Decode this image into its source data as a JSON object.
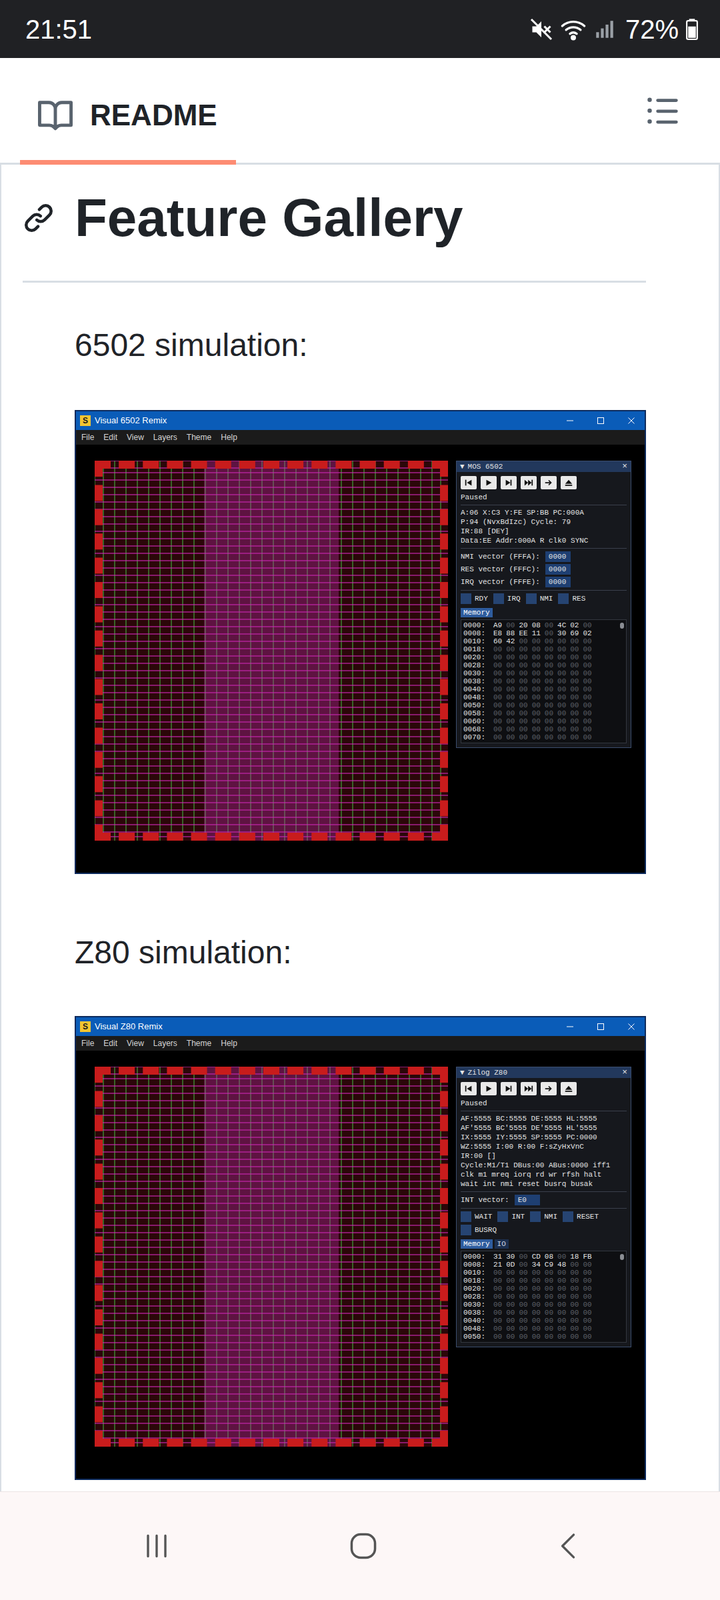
{
  "status_bar": {
    "time": "21:51",
    "battery": "72%"
  },
  "header": {
    "tabs": [
      {
        "label": "README",
        "selected": true
      }
    ]
  },
  "article": {
    "title": "Feature Gallery",
    "sections": [
      {
        "caption": "6502 simulation:",
        "window": {
          "logo": "S",
          "title": "Visual 6502 Remix",
          "menu": [
            "File",
            "Edit",
            "View",
            "Layers",
            "Theme",
            "Help"
          ],
          "panel": {
            "collapse": "▼",
            "title": "MOS 6502",
            "close": "×",
            "status": "Paused",
            "registers": [
              "A:06 X:C3 Y:FE SP:BB PC:000A",
              "P:94 (NvxBdIzc) Cycle: 79",
              "IR:88 [DEY]",
              "Data:EE Addr:000A R clk0 SYNC"
            ],
            "vectors": [
              {
                "label": "NMI vector (FFFA):",
                "value": "0000"
              },
              {
                "label": "RES vector (FFFC):",
                "value": "0000"
              },
              {
                "label": "IRQ vector (FFFE):",
                "value": "0000"
              }
            ],
            "pins": [
              {
                "label": "RDY",
                "checked": false
              },
              {
                "label": "IRQ",
                "checked": false
              },
              {
                "label": "NMI",
                "checked": false
              },
              {
                "label": "RES",
                "checked": false
              }
            ],
            "tabs": [
              {
                "label": "Memory",
                "selected": true
              }
            ],
            "memory": [
              {
                "address": "0000:",
                "bytes": [
                  "A9",
                  "00",
                  "20",
                  "08",
                  "00",
                  "4C",
                  "02",
                  "00"
                ]
              },
              {
                "address": "0008:",
                "bytes": [
                  "E8",
                  "88",
                  "EE",
                  "11",
                  "00",
                  "30",
                  "69",
                  "02"
                ]
              },
              {
                "address": "0010:",
                "bytes": [
                  "60",
                  "42",
                  "00",
                  "00",
                  "00",
                  "00",
                  "00",
                  "00"
                ]
              },
              {
                "address": "0018:",
                "bytes": [
                  "00",
                  "00",
                  "00",
                  "00",
                  "00",
                  "00",
                  "00",
                  "00"
                ]
              },
              {
                "address": "0020:",
                "bytes": [
                  "00",
                  "00",
                  "00",
                  "00",
                  "00",
                  "00",
                  "00",
                  "00"
                ]
              },
              {
                "address": "0028:",
                "bytes": [
                  "00",
                  "00",
                  "00",
                  "00",
                  "00",
                  "00",
                  "00",
                  "00"
                ]
              },
              {
                "address": "0030:",
                "bytes": [
                  "00",
                  "00",
                  "00",
                  "00",
                  "00",
                  "00",
                  "00",
                  "00"
                ]
              },
              {
                "address": "0038:",
                "bytes": [
                  "00",
                  "00",
                  "00",
                  "00",
                  "00",
                  "00",
                  "00",
                  "00"
                ]
              },
              {
                "address": "0040:",
                "bytes": [
                  "00",
                  "00",
                  "00",
                  "00",
                  "00",
                  "00",
                  "00",
                  "00"
                ]
              },
              {
                "address": "0048:",
                "bytes": [
                  "00",
                  "00",
                  "00",
                  "00",
                  "00",
                  "00",
                  "00",
                  "00"
                ]
              },
              {
                "address": "0050:",
                "bytes": [
                  "00",
                  "00",
                  "00",
                  "00",
                  "00",
                  "00",
                  "00",
                  "00"
                ]
              },
              {
                "address": "0058:",
                "bytes": [
                  "00",
                  "00",
                  "00",
                  "00",
                  "00",
                  "00",
                  "00",
                  "00"
                ]
              },
              {
                "address": "0060:",
                "bytes": [
                  "00",
                  "00",
                  "00",
                  "00",
                  "00",
                  "00",
                  "00",
                  "00"
                ]
              },
              {
                "address": "0068:",
                "bytes": [
                  "00",
                  "00",
                  "00",
                  "00",
                  "00",
                  "00",
                  "00",
                  "00"
                ]
              },
              {
                "address": "0070:",
                "bytes": [
                  "00",
                  "00",
                  "00",
                  "00",
                  "00",
                  "00",
                  "00",
                  "00"
                ]
              }
            ]
          }
        }
      },
      {
        "caption": "Z80 simulation:",
        "window": {
          "logo": "S",
          "title": "Visual Z80 Remix",
          "menu": [
            "File",
            "Edit",
            "View",
            "Layers",
            "Theme",
            "Help"
          ],
          "panel": {
            "collapse": "▼",
            "title": "Zilog Z80",
            "close": "×",
            "status": "Paused",
            "registers": [
              "AF:5555 BC:5555 DE:5555 HL:5555",
              "AF'5555 BC'5555 DE'5555 HL'5555",
              "IX:5555 IY:5555 SP:5555 PC:0000",
              "WZ:5555 I:00 R:00 F:sZyHxVnC",
              "IR:00 []",
              "Cycle:M1/T1 DBus:00 ABus:0000 iff1",
              "clk m1 mreq iorq rd wr rfsh halt",
              "wait int nmi reset busrq busak"
            ],
            "vectors": [
              {
                "label": "INT vector:",
                "value": "E0"
              }
            ],
            "pins": [
              {
                "label": "WAIT",
                "checked": false
              },
              {
                "label": "INT",
                "checked": false
              },
              {
                "label": "NMI",
                "checked": false
              },
              {
                "label": "RESET",
                "checked": false
              },
              {
                "label": "BUSRQ",
                "checked": false
              }
            ],
            "tabs": [
              {
                "label": "Memory",
                "selected": true
              },
              {
                "label": "IO",
                "selected": false
              }
            ],
            "memory": [
              {
                "address": "0000:",
                "bytes": [
                  "31",
                  "30",
                  "00",
                  "CD",
                  "08",
                  "00",
                  "18",
                  "FB"
                ]
              },
              {
                "address": "0008:",
                "bytes": [
                  "21",
                  "0D",
                  "00",
                  "34",
                  "C9",
                  "48",
                  "00",
                  "00"
                ]
              },
              {
                "address": "0010:",
                "bytes": [
                  "00",
                  "00",
                  "00",
                  "00",
                  "00",
                  "00",
                  "00",
                  "00"
                ]
              },
              {
                "address": "0018:",
                "bytes": [
                  "00",
                  "00",
                  "00",
                  "00",
                  "00",
                  "00",
                  "00",
                  "00"
                ]
              },
              {
                "address": "0020:",
                "bytes": [
                  "00",
                  "00",
                  "00",
                  "00",
                  "00",
                  "00",
                  "00",
                  "00"
                ]
              },
              {
                "address": "0028:",
                "bytes": [
                  "00",
                  "00",
                  "00",
                  "00",
                  "00",
                  "00",
                  "00",
                  "00"
                ]
              },
              {
                "address": "0030:",
                "bytes": [
                  "00",
                  "00",
                  "00",
                  "00",
                  "00",
                  "00",
                  "00",
                  "00"
                ]
              },
              {
                "address": "0038:",
                "bytes": [
                  "00",
                  "00",
                  "00",
                  "00",
                  "00",
                  "00",
                  "00",
                  "00"
                ]
              },
              {
                "address": "0040:",
                "bytes": [
                  "00",
                  "00",
                  "00",
                  "00",
                  "00",
                  "00",
                  "00",
                  "00"
                ]
              },
              {
                "address": "0048:",
                "bytes": [
                  "00",
                  "00",
                  "00",
                  "00",
                  "00",
                  "00",
                  "00",
                  "00"
                ]
              },
              {
                "address": "0050:",
                "bytes": [
                  "00",
                  "00",
                  "00",
                  "00",
                  "00",
                  "00",
                  "00",
                  "00"
                ]
              }
            ]
          }
        }
      }
    ]
  }
}
